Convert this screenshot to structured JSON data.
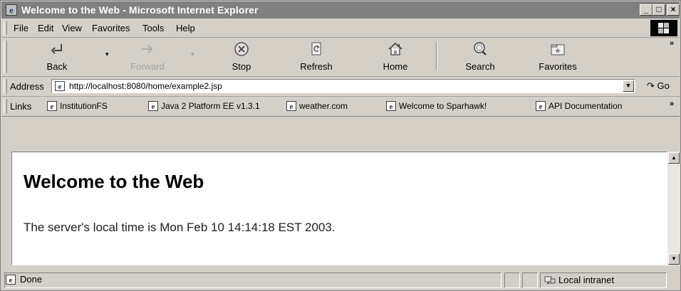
{
  "window": {
    "title": "Welcome to the Web - Microsoft Internet Explorer",
    "minimize_glyph": "_",
    "maximize_glyph": "□",
    "close_glyph": "×"
  },
  "menu": {
    "items": [
      "File",
      "Edit",
      "View",
      "Favorites",
      "Tools",
      "Help"
    ]
  },
  "toolbar": {
    "back": "Back",
    "forward": "Forward",
    "stop": "Stop",
    "refresh": "Refresh",
    "home": "Home",
    "search": "Search",
    "favorites": "Favorites",
    "overflow": "»",
    "dropdown_glyph": "▾"
  },
  "address_bar": {
    "label": "Address",
    "url": "http://localhost:8080/home/example2.jsp",
    "dropdown_glyph": "▼",
    "go_label": "Go",
    "go_glyph": "↷"
  },
  "links_bar": {
    "label": "Links",
    "items": [
      "InstitutionFS",
      "Java 2 Platform EE v1.3.1",
      "weather.com",
      "Welcome to Sparhawk!",
      "API Documentation"
    ],
    "overflow": "»"
  },
  "page": {
    "heading": "Welcome to the Web",
    "body": "The server's local time is Mon Feb 10 14:14:18 EST 2003."
  },
  "scrollbar": {
    "up_glyph": "▲",
    "down_glyph": "▼"
  },
  "status_bar": {
    "text": "Done",
    "zone": "Local intranet"
  },
  "icons": {
    "back": "back-arrow-icon",
    "forward": "forward-arrow-icon",
    "stop": "stop-icon",
    "refresh": "refresh-icon",
    "home": "home-icon",
    "search": "search-icon",
    "favorites": "favorites-icon",
    "page": "ie-page-icon",
    "zone": "intranet-icon"
  },
  "colors": {
    "chrome": "#d4d0c8",
    "titlebar_inactive": "#808080",
    "content_bg": "#ffffff"
  }
}
